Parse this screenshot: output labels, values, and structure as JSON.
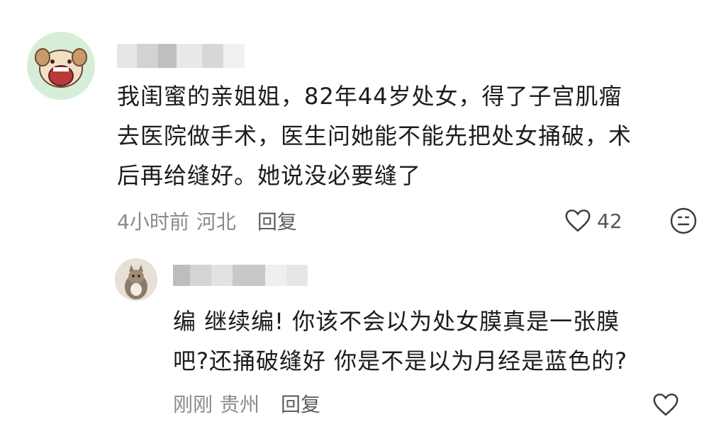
{
  "comment": {
    "text": "我闺蜜的亲姐姐，82年44岁处女，得了子宫肌瘤\n去医院做手术，医生问她能不能先把处女捅破，术\n后再给缝好。她说没必要缝了",
    "time": "4小时前",
    "location": "河北",
    "reply_label": "回复",
    "likes": "42",
    "avatar_icon": "cartoon-dog-avatar",
    "like_icon": "heart-icon",
    "emoji_icon": "smiley-face-icon"
  },
  "reply": {
    "text": "编 继续编! 你该不会以为处女膜真是一张膜\n吧?还捅破缝好 你是不是以为月经是蓝色的?",
    "time": "刚刚",
    "location": "贵州",
    "reply_label": "回复",
    "avatar_icon": "cat-photo-avatar",
    "like_icon": "heart-icon"
  }
}
